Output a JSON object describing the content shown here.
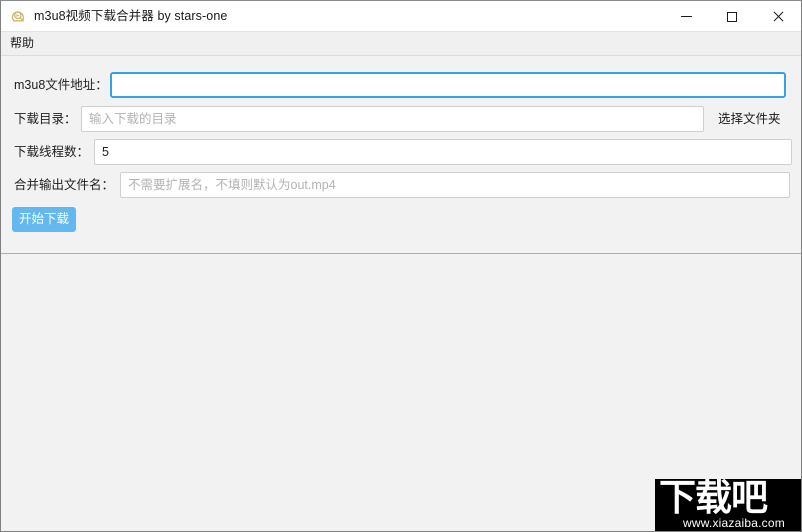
{
  "window": {
    "title": "m3u8视频下载合并器 by stars-one",
    "icon": "app-icon",
    "controls": {
      "minimize": "minimize-icon",
      "maximize": "maximize-icon",
      "close": "close-icon"
    }
  },
  "menubar": {
    "items": [
      {
        "label": "帮助"
      }
    ]
  },
  "form": {
    "rows": [
      {
        "label": "m3u8文件地址：",
        "value": "",
        "placeholder": "",
        "focused": true
      },
      {
        "label": "下载目录：",
        "value": "",
        "placeholder": "输入下载的目录",
        "focused": false
      },
      {
        "label": "下载线程数：",
        "value": "5",
        "placeholder": "",
        "focused": false
      },
      {
        "label": "合并输出文件名：",
        "value": "",
        "placeholder": "不需要扩展名，不填则默认为out.mp4",
        "focused": false
      }
    ],
    "pick_folder_label": "选择文件夹",
    "start_label": "开始下载"
  },
  "log": {
    "content": ""
  },
  "watermark": {
    "main": "下载吧",
    "url": "www.xiazaiba.com"
  },
  "colors": {
    "accent": "#63b8ef",
    "focus_border": "#33a3e8",
    "window_bg": "#f2f2f2",
    "titlebar_bg": "#ffffff",
    "menubar_bg": "#f0f0f0",
    "field_border": "#cfcfcf",
    "placeholder": "#b3b3b3",
    "watermark_bg": "#000000"
  }
}
